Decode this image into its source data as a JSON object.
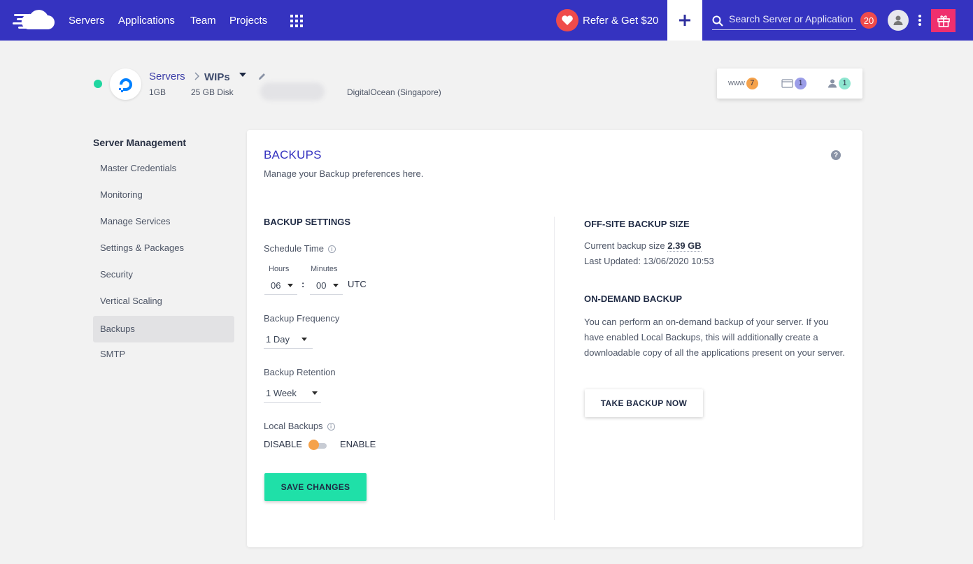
{
  "nav": {
    "links": [
      "Servers",
      "Applications",
      "Team",
      "Projects"
    ],
    "refer_label": "Refer & Get $20",
    "search_placeholder": "Search Server or Application",
    "notification_count": "20",
    "icons": [
      "cloud-logo-icon",
      "apps-grid-icon",
      "heart-icon",
      "plus-icon",
      "search-icon",
      "user-icon",
      "kebab-icon",
      "gift-icon"
    ]
  },
  "server": {
    "status_color": "#1fd6a0",
    "breadcrumb_root": "Servers",
    "name": "WIPs",
    "ram": "1GB",
    "disk": "25 GB Disk",
    "provider": "DigitalOcean (Singapore)",
    "stats": [
      {
        "label": "www",
        "count": "7",
        "color": "#f5a24b"
      },
      {
        "label": "",
        "count": "1",
        "color": "#9b9de8"
      },
      {
        "label": "",
        "count": "1",
        "color": "#8ee6d0"
      }
    ]
  },
  "sidebar": {
    "title": "Server Management",
    "items": [
      "Master Credentials",
      "Monitoring",
      "Manage Services",
      "Settings & Packages",
      "Security",
      "Vertical Scaling",
      "Backups",
      "SMTP"
    ],
    "active": "Backups"
  },
  "backups": {
    "title": "BACKUPS",
    "subtitle": "Manage your Backup preferences here.",
    "settings_heading": "BACKUP SETTINGS",
    "schedule_label": "Schedule Time",
    "hours_label": "Hours",
    "minutes_label": "Minutes",
    "hours_value": "06",
    "minutes_value": "00",
    "separator": ":",
    "timezone": "UTC",
    "frequency_label": "Backup Frequency",
    "frequency_value": "1 Day",
    "retention_label": "Backup Retention",
    "retention_value": "1 Week",
    "local_label": "Local Backups",
    "disable_label": "DISABLE",
    "enable_label": "ENABLE",
    "local_enabled": false,
    "save_label": "SAVE CHANGES",
    "offsite_heading": "OFF-SITE BACKUP SIZE",
    "current_size_label": "Current backup size",
    "current_size_value": "2.39 GB",
    "last_updated": "Last Updated: 13/06/2020 10:53",
    "ondemand_heading": "ON-DEMAND BACKUP",
    "ondemand_text": "You can perform an on-demand backup of your server. If you have enabled Local Backups, this will additionally create a downloadable copy of all the applications present on your server.",
    "take_backup_label": "TAKE BACKUP NOW"
  },
  "colors": {
    "nav_bg": "#3533c0",
    "accent_green": "#1fe0a8",
    "toggle_knob": "#f5a24b",
    "notif_red": "#ef4b4b",
    "gift_pink": "#ef2f6e"
  }
}
